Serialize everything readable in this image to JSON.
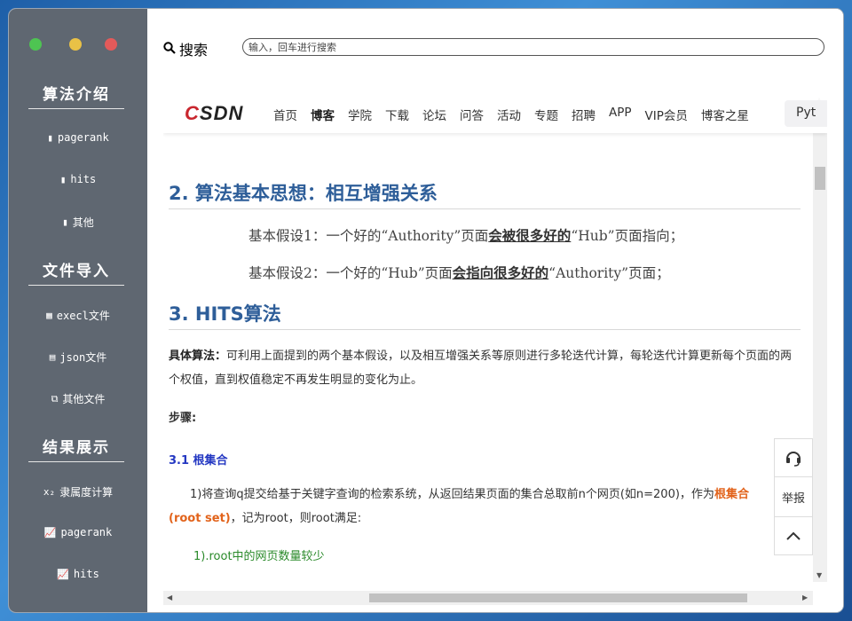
{
  "sidebar": {
    "sections": [
      {
        "title": "算法介绍",
        "items": [
          {
            "icon": "book-icon",
            "label": "pagerank"
          },
          {
            "icon": "book-icon",
            "label": "hits"
          },
          {
            "icon": "book-icon",
            "label": "其他"
          }
        ]
      },
      {
        "title": "文件导入",
        "items": [
          {
            "icon": "table-icon",
            "label": "execl文件"
          },
          {
            "icon": "file-icon",
            "label": "json文件"
          },
          {
            "icon": "copy-icon",
            "label": "其他文件"
          }
        ]
      },
      {
        "title": "结果展示",
        "items": [
          {
            "icon": "subscript-icon",
            "label": "隶属度计算"
          },
          {
            "icon": "line-chart-icon",
            "label": "pagerank"
          },
          {
            "icon": "line-chart-icon",
            "label": "hits"
          }
        ]
      }
    ]
  },
  "search": {
    "label": "搜索",
    "placeholder": "输入，回车进行搜索"
  },
  "csdn": {
    "logo": "CSDN",
    "menu": [
      "首页",
      "博客",
      "学院",
      "下载",
      "论坛",
      "问答",
      "活动",
      "专题",
      "招聘",
      "APP",
      "VIP会员",
      "博客之星"
    ],
    "active": "博客",
    "chip": "Pyt"
  },
  "article": {
    "h2_1": "2. 算法基本思想：相互增强关系",
    "assume1_pre": "基本假设1：一个好的“Authority”页面",
    "assume1_bold": "会被很多好的",
    "assume1_post": "“Hub”页面指向；",
    "assume2_pre": "基本假设2：一个好的“Hub”页面",
    "assume2_bold": "会指向很多好的",
    "assume2_post": "“Authority”页面；",
    "h2_2": "3. HITS算法",
    "algo_bold": "具体算法：",
    "algo_text": "可利用上面提到的两个基本假设，以及相互增强关系等原则进行多轮迭代计算，每轮迭代计算更新每个页面的两个权值，直到权值稳定不再发生明显的变化为止。",
    "steps_label": "步骤:",
    "sub_31": "3.1 根集合",
    "step1_a": "1)将查询q提交给基于关键字查询的检索系统，从返回结果页面的集合总取前n个网页(如n=200)，作为",
    "step1_b": "根集合",
    "step1_c": "(root set)",
    "step1_d": "，记为root，则root满足:",
    "item1": "1).root中的网页数量较少"
  },
  "float_buttons": {
    "report": "举报"
  }
}
